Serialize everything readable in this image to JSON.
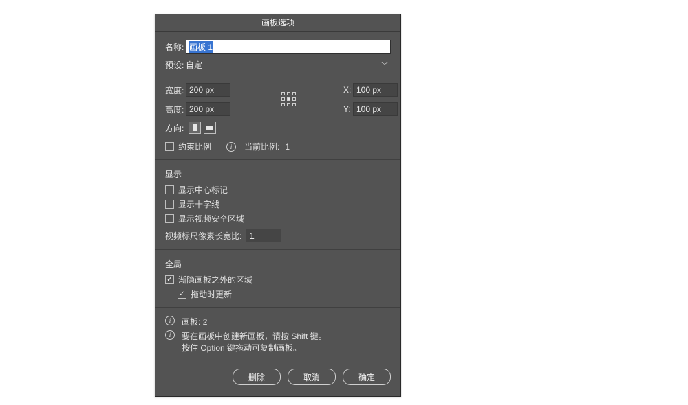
{
  "dialog": {
    "title": "画板选项",
    "name_label": "名称:",
    "name_value": "画板 1",
    "preset_label": "预设:",
    "preset_value": "自定",
    "width_label": "宽度:",
    "width_value": "200 px",
    "height_label": "高度:",
    "height_value": "200 px",
    "x_label": "X:",
    "x_value": "100 px",
    "y_label": "Y:",
    "y_value": "100 px",
    "orientation_label": "方向:",
    "constrain_label": "约束比例",
    "current_ratio_label": "当前比例:",
    "current_ratio_value": "1",
    "display_section": "显示",
    "show_center_mark": "显示中心标记",
    "show_cross_hairs": "显示十字线",
    "show_video_safe": "显示视频安全区域",
    "video_ruler_ratio_label": "视频标尺像素长宽比:",
    "video_ruler_ratio_value": "1",
    "global_section": "全局",
    "fade_outside_label": "渐隐画板之外的区域",
    "update_drag_label": "拖动时更新",
    "info_artboards_label": "画板:",
    "info_artboards_count": "2",
    "info_hint_line1": "要在画板中创建新画板，请按 Shift 键。",
    "info_hint_line2": "按住 Option 键拖动可复制画板。",
    "btn_delete": "删除",
    "btn_cancel": "取消",
    "btn_ok": "确定"
  },
  "state": {
    "constrain_checked": false,
    "show_center_checked": false,
    "show_cross_checked": false,
    "show_video_checked": false,
    "fade_outside_checked": true,
    "update_drag_checked": true
  }
}
